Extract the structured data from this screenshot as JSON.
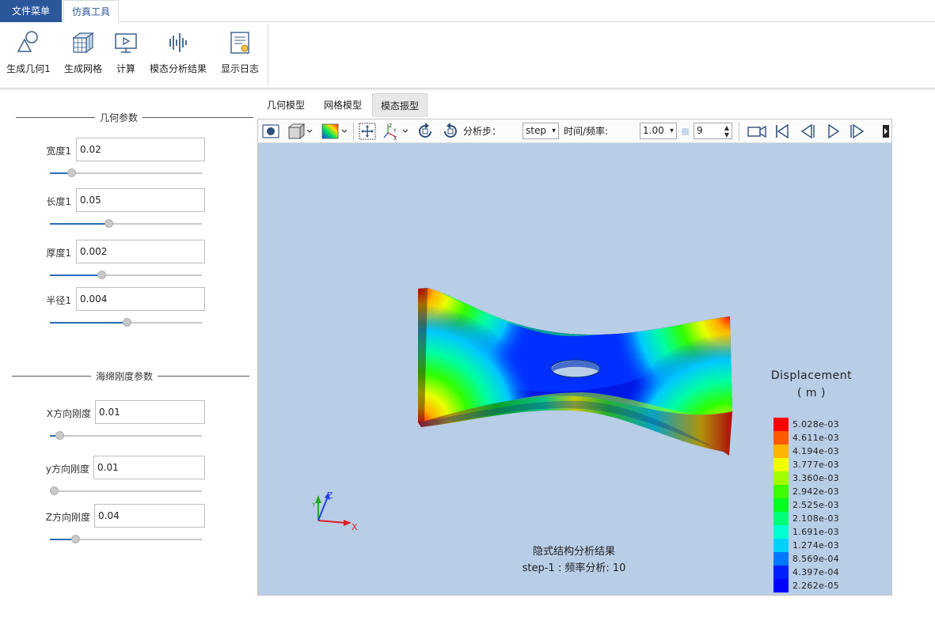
{
  "tabs": {
    "file": "文件菜单",
    "sim": "仿真工具"
  },
  "ribbon": [
    {
      "label": "生成几何1",
      "icon": "geometry-icon"
    },
    {
      "label": "生成网格",
      "icon": "mesh-icon"
    },
    {
      "label": "计算",
      "icon": "compute-icon"
    },
    {
      "label": "模态分析结果",
      "icon": "modal-results-icon"
    },
    {
      "label": "显示日志",
      "icon": "log-icon"
    }
  ],
  "geometry_group": {
    "title": "几何参数",
    "params": [
      {
        "label": "宽度1",
        "value": "0.02",
        "slider": 0.12
      },
      {
        "label": "长度1",
        "value": "0.05",
        "slider": 0.38
      },
      {
        "label": "厚度1",
        "value": "0.002",
        "slider": 0.33
      },
      {
        "label": "半径1",
        "value": "0.004",
        "slider": 0.51
      }
    ]
  },
  "sponge_group": {
    "title": "海绵刚度参数",
    "params": [
      {
        "label": "X方向刚度",
        "value": "0.01",
        "slider": 0.04
      },
      {
        "label": "y方向刚度",
        "value": "0.01",
        "slider": 0.0
      },
      {
        "label": "Z方向刚度",
        "value": "0.04",
        "slider": 0.15
      }
    ]
  },
  "view_tabs": [
    "几何模型",
    "网格模型",
    "模态振型"
  ],
  "toolbar": {
    "step_label": "分析步：",
    "step_value": "step",
    "time_label": "时间/频率:",
    "time_value": "1.00",
    "frame_value": "9"
  },
  "legend": {
    "title": "Displacement",
    "unit": "( m )",
    "entries": [
      {
        "label": "5.028e-03",
        "color": "#ff0000"
      },
      {
        "label": "4.611e-03",
        "color": "#ff5a00"
      },
      {
        "label": "4.194e-03",
        "color": "#ffb400"
      },
      {
        "label": "3.777e-03",
        "color": "#f2ff00"
      },
      {
        "label": "3.360e-03",
        "color": "#a0ff00"
      },
      {
        "label": "2.942e-03",
        "color": "#3cff00"
      },
      {
        "label": "2.525e-03",
        "color": "#00ff1e"
      },
      {
        "label": "2.108e-03",
        "color": "#00ff78"
      },
      {
        "label": "1.691e-03",
        "color": "#00ffd2"
      },
      {
        "label": "1.274e-03",
        "color": "#00d2ff"
      },
      {
        "label": "8.569e-04",
        "color": "#0078ff"
      },
      {
        "label": "4.397e-04",
        "color": "#001eff"
      },
      {
        "label": "2.262e-05",
        "color": "#0000ff"
      }
    ]
  },
  "axes": {
    "x": "X",
    "y": "Y",
    "z": "Z"
  },
  "caption": {
    "line1": "隐式结构分析结果",
    "line2": "step-1 : 频率分析: 10"
  }
}
